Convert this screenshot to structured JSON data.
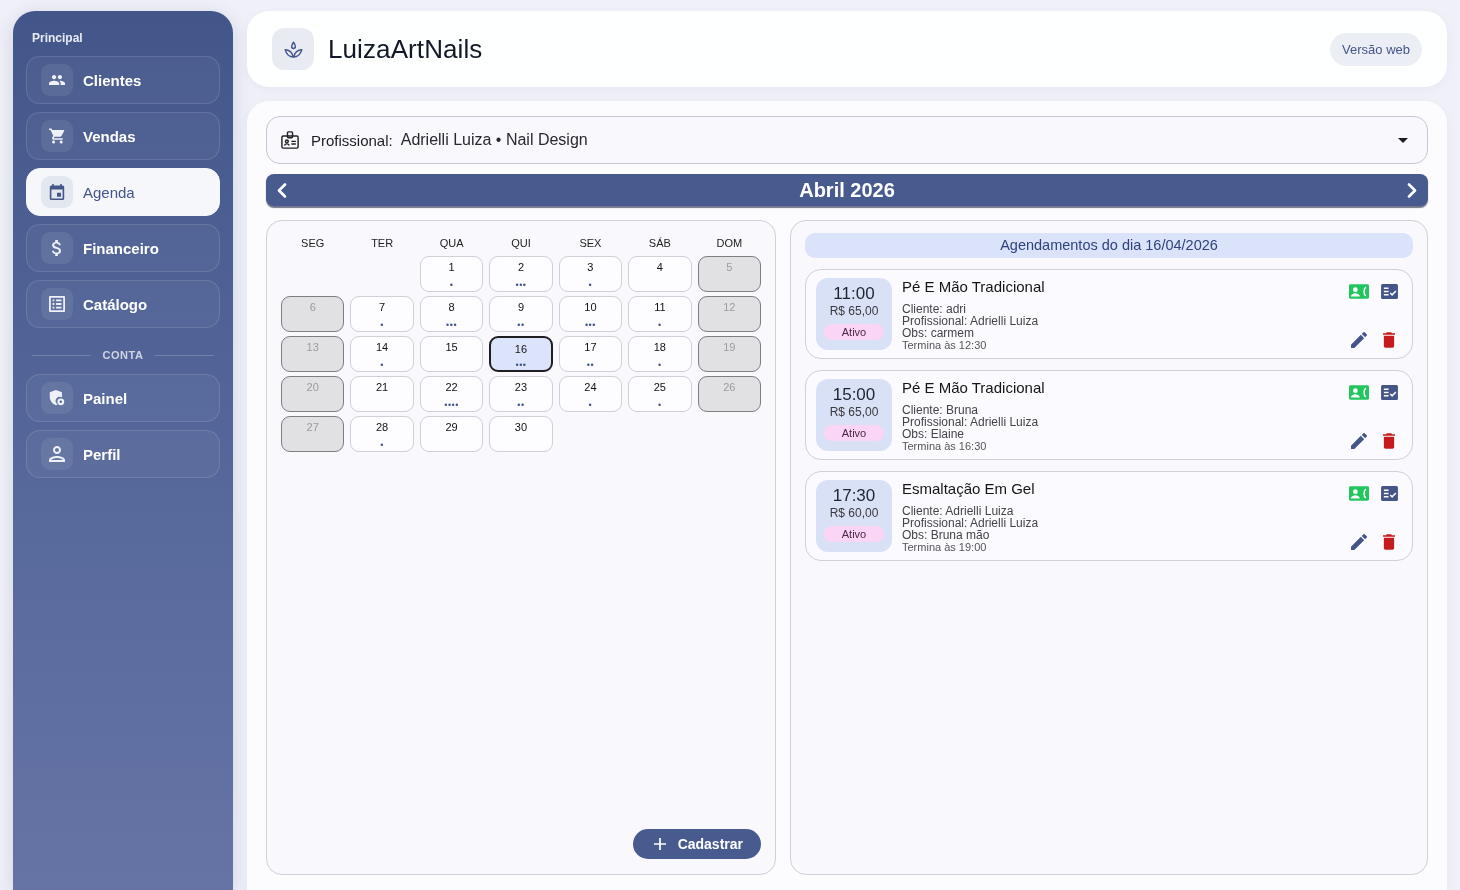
{
  "sidebar": {
    "sections": [
      {
        "kind": "heading",
        "title": "Principal",
        "items": [
          {
            "label": "Clientes",
            "selected": false
          },
          {
            "label": "Vendas",
            "selected": false
          },
          {
            "label": "Agenda",
            "selected": true
          },
          {
            "label": "Financeiro",
            "selected": false
          },
          {
            "label": "Catálogo",
            "selected": false
          }
        ]
      },
      {
        "kind": "divider",
        "title": "CONTA",
        "items": [
          {
            "label": "Painel",
            "selected": false
          },
          {
            "label": "Perfil",
            "selected": false
          }
        ]
      }
    ]
  },
  "header": {
    "title": "LuizaArtNails",
    "web_version_button": "Versão web"
  },
  "professional_select": {
    "label": "Profissional:",
    "value": "Adrielli Luiza • Nail Design"
  },
  "calendar": {
    "month_title": "Abril 2026",
    "weekdays": [
      "SEG",
      "TER",
      "QUA",
      "QUI",
      "SEX",
      "SÁB",
      "DOM"
    ],
    "weeks": [
      {
        "days": [
          {
            "day": "1",
            "dots": "•",
            "closed": false,
            "selected": false
          },
          {
            "day": "2",
            "dots": "•••",
            "closed": false,
            "selected": false
          },
          {
            "day": "3",
            "dots": "•",
            "closed": false,
            "selected": false
          },
          {
            "day": "4",
            "closed": false,
            "selected": false
          },
          {
            "day": "5",
            "closed": true,
            "selected": false
          }
        ]
      },
      {
        "days": [
          {
            "day": "6",
            "closed": true,
            "selected": false
          },
          {
            "day": "7",
            "dots": "•",
            "closed": false,
            "selected": false
          },
          {
            "day": "8",
            "dots": "•••",
            "closed": false,
            "selected": false
          },
          {
            "day": "9",
            "dots": "••",
            "closed": false,
            "selected": false
          },
          {
            "day": "10",
            "dots": "•••",
            "closed": false,
            "selected": false
          },
          {
            "day": "11",
            "dots": "•",
            "closed": false,
            "selected": false
          },
          {
            "day": "12",
            "closed": true,
            "selected": false
          }
        ]
      },
      {
        "days": [
          {
            "day": "13",
            "closed": true,
            "selected": false
          },
          {
            "day": "14",
            "dots": "•",
            "closed": false,
            "selected": false
          },
          {
            "day": "15",
            "closed": false,
            "selected": false
          },
          {
            "day": "16",
            "dots": "•••",
            "closed": false,
            "selected": true
          },
          {
            "day": "17",
            "dots": "••",
            "closed": false,
            "selected": false
          },
          {
            "day": "18",
            "dots": "•",
            "closed": false,
            "selected": false
          },
          {
            "day": "19",
            "closed": true,
            "selected": false
          }
        ]
      },
      {
        "days": [
          {
            "day": "20",
            "closed": true,
            "selected": false
          },
          {
            "day": "21",
            "closed": false,
            "selected": false
          },
          {
            "day": "22",
            "dots": "••••",
            "closed": false,
            "selected": false
          },
          {
            "day": "23",
            "dots": "••",
            "closed": false,
            "selected": false
          },
          {
            "day": "24",
            "dots": "•",
            "closed": false,
            "selected": false
          },
          {
            "day": "25",
            "dots": "•",
            "closed": false,
            "selected": false
          },
          {
            "day": "26",
            "closed": true,
            "selected": false
          }
        ]
      },
      {
        "days": [
          {
            "day": "27",
            "closed": true,
            "selected": false
          },
          {
            "day": "28",
            "dots": "•",
            "closed": false,
            "selected": false
          },
          {
            "day": "29",
            "closed": false,
            "selected": false
          },
          {
            "day": "30",
            "closed": false,
            "selected": false
          }
        ]
      }
    ],
    "add_button": "Cadastrar"
  },
  "appointments": {
    "heading": "Agendamentos do dia 16/04/2026",
    "items": [
      {
        "time": "11:00",
        "price": "R$ 65,00",
        "status": "Ativo",
        "service": "Pé E Mão Tradicional",
        "client": "Cliente: adri",
        "professional": "Profissional: Adrielli Luiza",
        "notes": "Obs: carmem",
        "ends": "Termina às 12:30"
      },
      {
        "time": "15:00",
        "price": "R$ 65,00",
        "status": "Ativo",
        "service": "Pé E Mão Tradicional",
        "client": "Cliente: Bruna",
        "professional": "Profissional: Adrielli Luiza",
        "notes": "Obs: Elaine",
        "ends": "Termina às 16:30"
      },
      {
        "time": "17:30",
        "price": "R$ 60,00",
        "status": "Ativo",
        "service": "Esmaltação Em Gel",
        "client": "Cliente: Adrielli Luiza",
        "professional": "Profissional: Adrielli Luiza",
        "notes": "Obs: Bruna mão",
        "ends": "Termina às 19:00"
      }
    ]
  }
}
